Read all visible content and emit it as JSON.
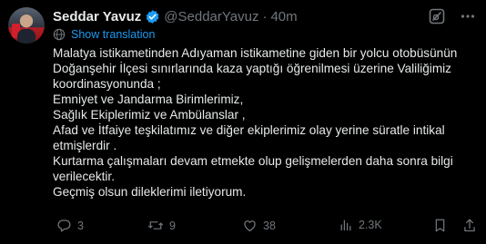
{
  "author": {
    "name": "Seddar Yavuz",
    "handle": "@SeddarYavuz",
    "separator": "·",
    "time": "40m"
  },
  "translate_label": "Show translation",
  "body_lines": [
    "Malatya istikametinden Adıyaman istikametine giden bir yolcu otobüsünün",
    "Doğanşehir İlçesi sınırlarında kaza yaptığı öğrenilmesi üzerine Valiliğimiz",
    "koordinasyonunda ;",
    "Emniyet ve Jandarma Birimlerimiz,",
    "Sağlık Ekiplerimiz ve Ambülanslar ,",
    "Afad ve İtfaiye teşkilatımız ve diğer ekiplerimiz olay yerine süratle intikal",
    "etmişlerdir .",
    "Kurtarma çalışmaları devam etmekte olup gelişmelerden daha sonra bilgi",
    "verilecektir.",
    "Geçmiş olsun dileklerimi iletiyorum."
  ],
  "actions": {
    "replies": "3",
    "reposts": "9",
    "likes": "38",
    "views": "2.3K"
  },
  "colors": {
    "background": "#000000",
    "text": "#e7e9ea",
    "muted": "#71767b",
    "accent": "#1d9bf0"
  },
  "icons": [
    "verified-badge-icon",
    "grok-icon",
    "more-icon",
    "translate-icon",
    "reply-icon",
    "repost-icon",
    "like-icon",
    "views-icon"
  ]
}
